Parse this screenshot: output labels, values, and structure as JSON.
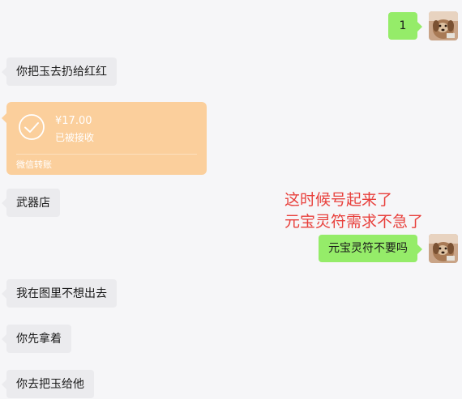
{
  "chat": {
    "messages": [
      {
        "direction": "out",
        "text": "1"
      },
      {
        "direction": "in",
        "text": "你把玉去扔给红红"
      },
      {
        "direction": "in",
        "type": "transfer",
        "amount": "¥17.00",
        "status": "已被接收",
        "label": "微信转账"
      },
      {
        "direction": "in",
        "text": "武器店"
      },
      {
        "direction": "out",
        "text": "元宝灵符不要吗"
      },
      {
        "direction": "in",
        "text": "我在图里不想出去"
      },
      {
        "direction": "in",
        "text": "你先拿着"
      },
      {
        "direction": "in",
        "text": "你去把玉给他"
      }
    ]
  },
  "annotation": {
    "line1": "这时候号起来了",
    "line2": "元宝灵符需求不急了",
    "color": "#e8403c"
  },
  "colors": {
    "background": "#f6f6f8",
    "incoming_bubble": "#ebebee",
    "outgoing_bubble": "#95ec69",
    "transfer_card": "#fbcf9c"
  },
  "icons": {
    "avatar": "dog-avatar-icon",
    "transfer_received": "check-circle-icon"
  }
}
